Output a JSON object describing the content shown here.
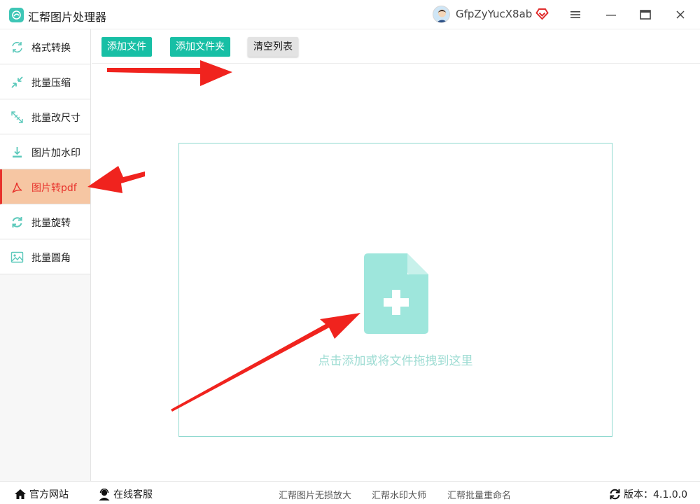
{
  "app": {
    "title": "汇帮图片处理器"
  },
  "user": {
    "name": "GfpZyYucX8ab"
  },
  "window_controls": {
    "menu": "≡",
    "minimize": "—",
    "maximize": "▭",
    "close": "✕"
  },
  "sidebar": {
    "items": [
      {
        "label": "格式转换",
        "icon": "convert-icon"
      },
      {
        "label": "批量压缩",
        "icon": "compress-icon"
      },
      {
        "label": "批量改尺寸",
        "icon": "resize-icon"
      },
      {
        "label": "图片加水印",
        "icon": "watermark-icon"
      },
      {
        "label": "图片转pdf",
        "icon": "pdf-icon",
        "active": true
      },
      {
        "label": "批量旋转",
        "icon": "rotate-icon"
      },
      {
        "label": "批量圆角",
        "icon": "image-icon"
      }
    ]
  },
  "toolbar": {
    "add_file": "添加文件",
    "add_folder": "添加文件夹",
    "clear_list": "清空列表"
  },
  "dropzone": {
    "text": "点击添加或将文件拖拽到这里"
  },
  "footer": {
    "website": "官方网站",
    "support": "在线客服",
    "links": [
      "汇帮图片无损放大",
      "汇帮水印大师",
      "汇帮批量重命名"
    ],
    "version": "版本：4.1.0.0"
  },
  "colors": {
    "accent": "#17bfa5",
    "active_bg": "#f6c6a3",
    "active_text": "#e8312b",
    "arrow": "#f0231e"
  }
}
